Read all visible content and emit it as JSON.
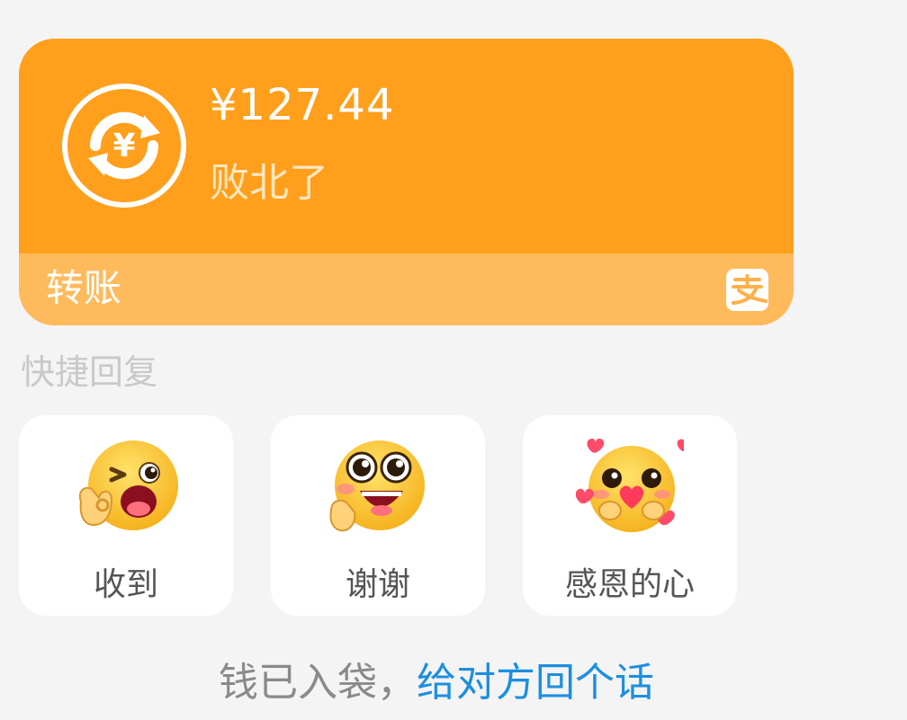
{
  "transfer": {
    "amount": "¥127.44",
    "memo": "败北了",
    "type_label": "转账",
    "icon": "yuan-exchange-icon",
    "logo": "alipay-logo",
    "colors": {
      "top": "#ff9f1c",
      "bottom": "#ffba5c",
      "memo_text": "#ffe7c2"
    }
  },
  "quick_reply": {
    "title": "快捷回复",
    "items": [
      {
        "label": "收到",
        "icon": "ok-wink-emoji-icon"
      },
      {
        "label": "谢谢",
        "icon": "grateful-emoji-icon"
      },
      {
        "label": "感恩的心",
        "icon": "hearts-emoji-icon"
      }
    ]
  },
  "footer": {
    "static_text": "钱已入袋，",
    "link_text": "给对方回个话",
    "link_color": "#1c8fdf"
  }
}
